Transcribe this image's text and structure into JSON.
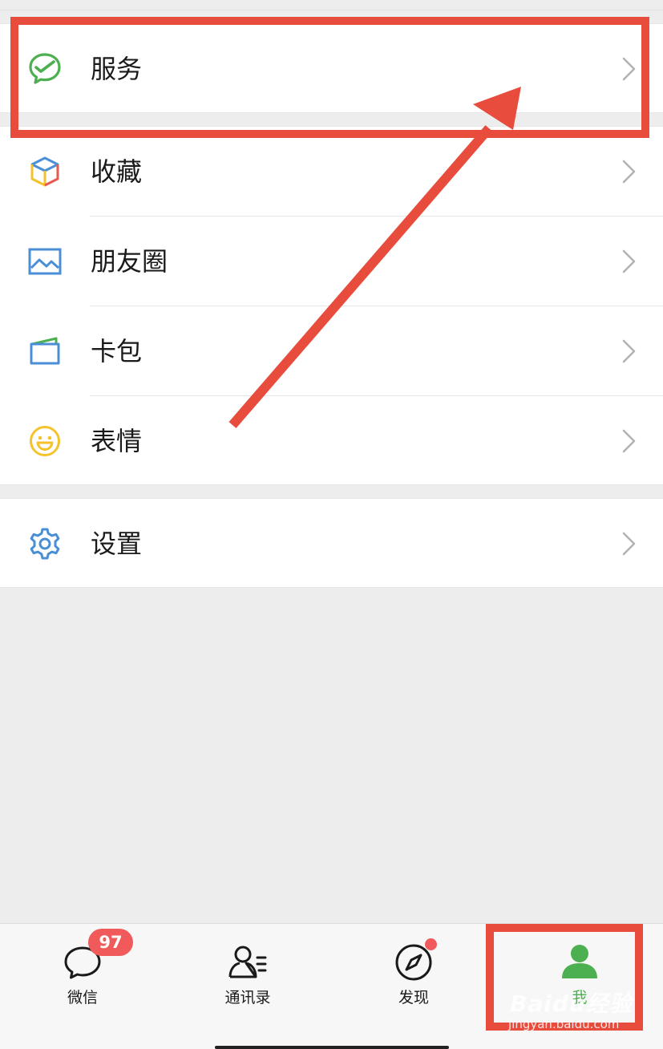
{
  "menu": {
    "group1": [
      {
        "label": "服务",
        "icon": "service-icon"
      }
    ],
    "group2": [
      {
        "label": "收藏",
        "icon": "favorites-cube-icon"
      },
      {
        "label": "朋友圈",
        "icon": "moments-photo-icon"
      },
      {
        "label": "卡包",
        "icon": "card-wallet-icon"
      },
      {
        "label": "表情",
        "icon": "sticker-smiley-icon"
      }
    ],
    "group3": [
      {
        "label": "设置",
        "icon": "settings-gear-icon"
      }
    ],
    "chevron_icon": "chevron-right-icon"
  },
  "tabbar": {
    "tabs": [
      {
        "label": "微信",
        "icon": "chat-bubble-icon",
        "badge": "97"
      },
      {
        "label": "通讯录",
        "icon": "contacts-icon"
      },
      {
        "label": "发现",
        "icon": "compass-icon",
        "has_dot": true
      },
      {
        "label": "我",
        "icon": "me-person-icon",
        "active": true
      }
    ]
  },
  "watermark": {
    "main": "Baidu经验",
    "sub": "jingyan.baidu.com"
  },
  "colors": {
    "accent_green": "#4caf50",
    "badge_red": "#f05a5a",
    "annotation_red": "#e84c3d",
    "background": "#ededed"
  }
}
